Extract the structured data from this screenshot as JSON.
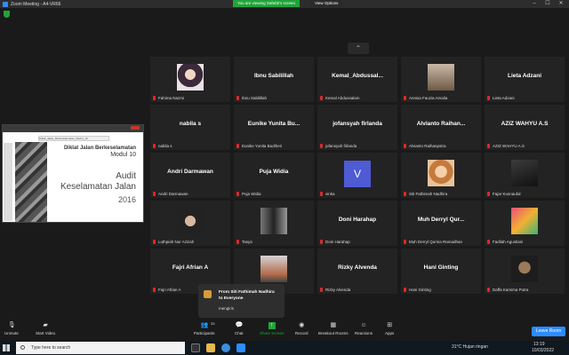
{
  "window": {
    "title": "Zoom Meeting - A4-VR66",
    "share_banner": "You are viewing Safebb's screen",
    "view_options": "View Options",
    "minimize": "–",
    "maximize": "☐",
    "close": "✕"
  },
  "shared_screen": {
    "tab_text": "Diklat_Jalan_Berkeselamatan_Modul_10",
    "line1": "Diklat Jalan Berkeselamatan",
    "line2": "Modul 10",
    "line3": "Audit",
    "line4": "Keselamatan Jalan",
    "line5": "2016"
  },
  "collapse_glyph": "⌃",
  "participants": [
    {
      "display": "",
      "label": "Fahima Nazmi",
      "avatar": "hijab-photo"
    },
    {
      "display": "Ibnu Sabilillah",
      "label": "Ibnu Sabilillah"
    },
    {
      "display": "Kemal_Abdussal...",
      "label": "Kemal Abdussalam"
    },
    {
      "display": "",
      "label": "Annisa Fauzia Amalia",
      "avatar": "room-photo"
    },
    {
      "display": "Lieta Adzani",
      "label": "Lieta Adzani"
    },
    {
      "display": "nabila s",
      "label": "nabila s"
    },
    {
      "display": "Eunike Yunita Bu...",
      "label": "Eunike Yunita Budiheri"
    },
    {
      "display": "jofansyah firlanda",
      "label": "jofansyah firlanda"
    },
    {
      "display": "Alvianto Raihan...",
      "label": "Alvianto Raihanpstra"
    },
    {
      "display": "AZIZ WAHYU A.S",
      "label": "AZIZ WAHYU A.S"
    },
    {
      "display": "Andri Darmawan",
      "label": "Andri Darmawan"
    },
    {
      "display": "Puja Widia",
      "label": "Puja Widia"
    },
    {
      "display": "",
      "label": "vinka",
      "avatar": "letter",
      "letter": "V"
    },
    {
      "display": "",
      "label": "Siti Fathimah Nadhira",
      "avatar": "anime-photo"
    },
    {
      "display": "",
      "label": "Fajar Kusnaufal",
      "avatar": "dark-photo"
    },
    {
      "display": "",
      "label": "Luthpiah Nur Azizah",
      "avatar": "face-photo"
    },
    {
      "display": "",
      "label": "Tasya",
      "avatar": "group-photo"
    },
    {
      "display": "Doni Harahap",
      "label": "Doni Harahap"
    },
    {
      "display": "Muh Derryl Qur...",
      "label": "Muh Derryl Qurnia Ramadhan"
    },
    {
      "display": "",
      "label": "Fadilah Agustiani",
      "avatar": "colorful-photo"
    },
    {
      "display": "Fajri Afrian A",
      "label": "Fajri Afrian A"
    },
    {
      "display": "",
      "label": "",
      "avatar": "building-photo"
    },
    {
      "display": "Rizky Alvenda",
      "label": "Rizky Alvenda"
    },
    {
      "display": "Hani Ginting",
      "label": "Hani Ginting"
    },
    {
      "display": "",
      "label": "Daffa Karisma Putra",
      "avatar": "man-photo"
    }
  ],
  "chat_popup": {
    "from_line1": "From Siti Fathimah Nadhira",
    "from_line2": "to Everyone",
    "message": "mengiris"
  },
  "toolbar": {
    "unmute": "Unmute",
    "start_video": "Start Video",
    "participants": "Participants",
    "participants_count": "33",
    "chat": "Chat",
    "share_screen": "Share Screen",
    "record": "Record",
    "breakout_rooms": "Breakout Rooms",
    "reactions": "Reactions",
    "apps": "Apps",
    "leave": "Leave Room"
  },
  "taskbar": {
    "search_placeholder": "Type here to search",
    "weather": "31°C  Hujan ringan",
    "time": "13:19",
    "date": "10/03/2022"
  },
  "colors": {
    "accent": "#2d8cff",
    "share_green": "#21a33a",
    "muted_red": "#e02828"
  }
}
